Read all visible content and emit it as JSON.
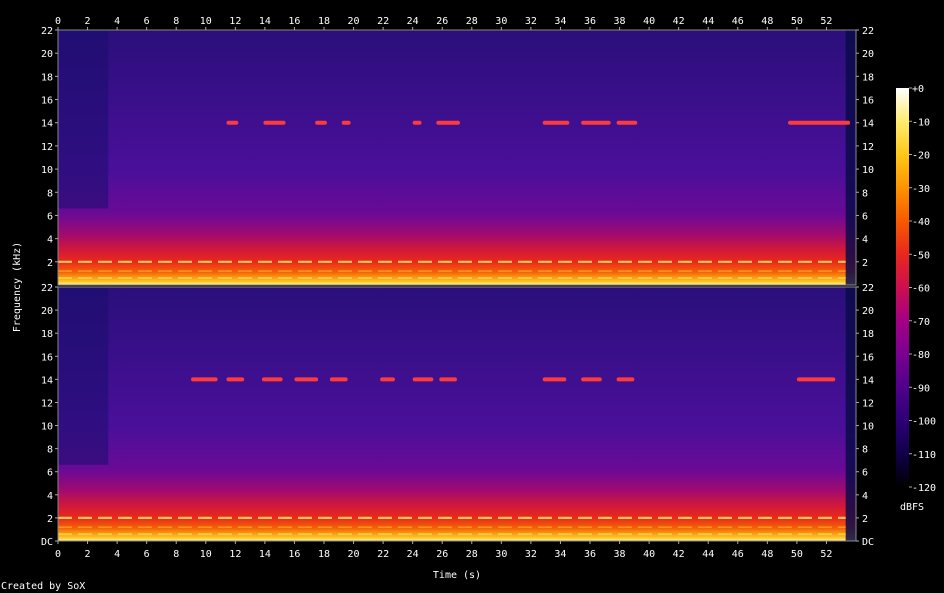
{
  "chart_data": {
    "type": "heatmap",
    "title": "",
    "xlabel": "Time (s)",
    "ylabel": "Frequency (kHz)",
    "x_range": [
      0,
      54
    ],
    "x_ticks": [
      "0",
      "2",
      "4",
      "6",
      "8",
      "10",
      "12",
      "14",
      "16",
      "18",
      "20",
      "22",
      "24",
      "26",
      "28",
      "30",
      "32",
      "34",
      "36",
      "38",
      "40",
      "42",
      "44",
      "46",
      "48",
      "50",
      "52"
    ],
    "y_range_khz": [
      0,
      22
    ],
    "channels": [
      {
        "y_ticks_left": [
          "22",
          "20",
          "18",
          "16",
          "14",
          "12",
          "10",
          "8",
          "6",
          "4",
          "2"
        ],
        "y_ticks_right": [
          "22",
          "20",
          "18",
          "16",
          "14",
          "12",
          "10",
          "8",
          "6",
          "4",
          "2"
        ],
        "tone_14khz_segments_s": [
          [
            11.4,
            12.2
          ],
          [
            13.9,
            15.4
          ],
          [
            17.4,
            18.2
          ],
          [
            19.2,
            19.8
          ],
          [
            24.0,
            24.6
          ],
          [
            25.6,
            27.2
          ],
          [
            32.8,
            34.6
          ],
          [
            35.4,
            37.4
          ],
          [
            37.8,
            39.2
          ],
          [
            49.4,
            53.6
          ]
        ]
      },
      {
        "y_ticks_left": [
          "22",
          "20",
          "18",
          "16",
          "14",
          "12",
          "10",
          "8",
          "6",
          "4",
          "2",
          "DC"
        ],
        "y_ticks_right": [
          "22",
          "20",
          "18",
          "16",
          "14",
          "12",
          "10",
          "8",
          "6",
          "4",
          "2",
          "DC"
        ],
        "tone_14khz_segments_s": [
          [
            9.0,
            10.8
          ],
          [
            11.4,
            12.6
          ],
          [
            13.8,
            15.2
          ],
          [
            16.0,
            17.6
          ],
          [
            18.4,
            19.6
          ],
          [
            21.8,
            22.8
          ],
          [
            24.0,
            25.4
          ],
          [
            25.8,
            27.0
          ],
          [
            32.8,
            34.4
          ],
          [
            35.4,
            36.8
          ],
          [
            37.8,
            39.0
          ],
          [
            50.0,
            52.6
          ]
        ]
      }
    ],
    "colorbar": {
      "unit": "dBFS",
      "range": [
        -120,
        0
      ],
      "ticks": [
        "+0",
        "-10",
        "-20",
        "-30",
        "-40",
        "-50",
        "-60",
        "-70",
        "-80",
        "-90",
        "-100",
        "-110",
        "-120"
      ],
      "colors": [
        "#000000",
        "#10004a",
        "#2d0076",
        "#50008c",
        "#7a0090",
        "#a40084",
        "#cc0f4f",
        "#e9271e",
        "#f75a00",
        "#fc9300",
        "#ffc81a",
        "#ffec70",
        "#ffffff"
      ]
    }
  },
  "footer": {
    "credit": "Created by SoX"
  }
}
